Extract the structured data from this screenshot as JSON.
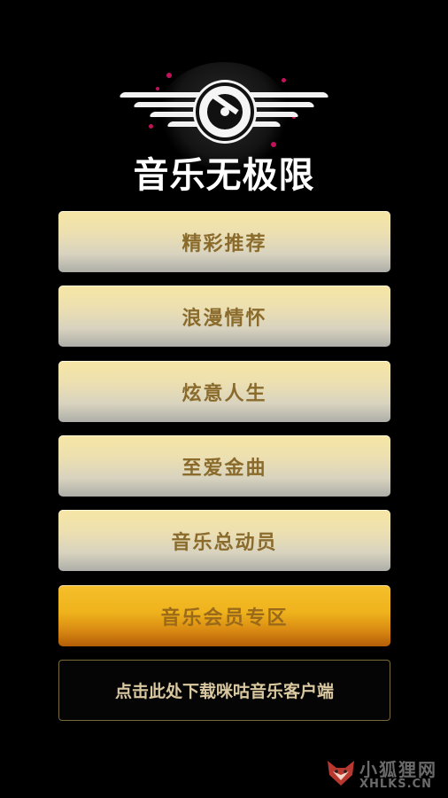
{
  "logo": {
    "title": "音乐无极限",
    "icon": "vinyl-disc-with-wings"
  },
  "menu": {
    "items": [
      {
        "label": "精彩推荐"
      },
      {
        "label": "浪漫情怀"
      },
      {
        "label": "炫意人生"
      },
      {
        "label": "至爱金曲"
      },
      {
        "label": "音乐总动员"
      },
      {
        "label": "音乐会员专区"
      }
    ]
  },
  "download": {
    "label": "点击此处下载咪咕音乐客户端"
  },
  "watermark": {
    "cn": "小狐狸网",
    "en": "XHLKS.CN"
  },
  "colors": {
    "background": "#000000",
    "button_gold": "#f6e6a4",
    "button_vip": "#eeb21c",
    "button_text": "#8a6b2c",
    "splash": "#c0135a"
  }
}
